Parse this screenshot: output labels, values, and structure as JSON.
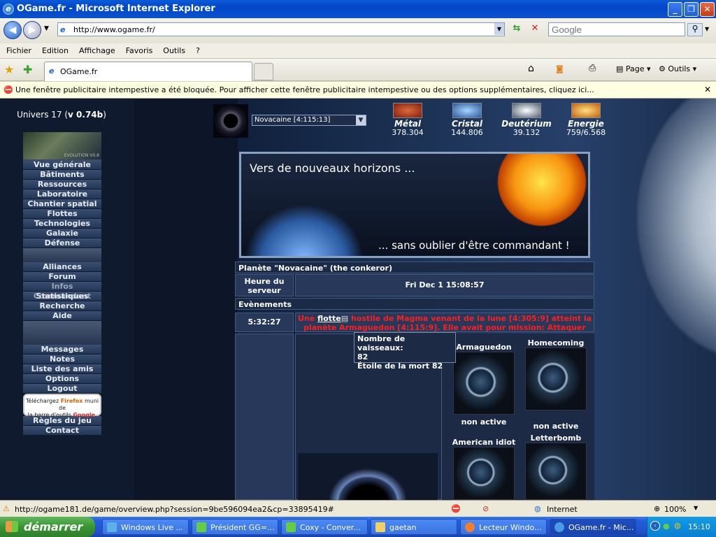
{
  "window": {
    "title": "OGame.fr - Microsoft Internet Explorer"
  },
  "address": {
    "url": "http://www.ogame.fr/",
    "search_placeholder": "Google"
  },
  "menu": [
    "Fichier",
    "Edition",
    "Affichage",
    "Favoris",
    "Outils",
    "?"
  ],
  "tab": {
    "label": "OGame.fr"
  },
  "toolbar": {
    "page_label": "Page",
    "tools_label": "Outils"
  },
  "popup_bar": {
    "text": "Une fenêtre publicitaire intempestive a été bloquée. Pour afficher cette fenêtre publicitaire intempestive ou des options supplémentaires, cliquez ici..."
  },
  "sidebar": {
    "univers": "Univers 17 (",
    "version": "v 0.74b",
    "univers_end": ")",
    "logo_caption": "EVOLUTION V0.8",
    "items_group1": [
      "Vue générale",
      "Bâtiments",
      "Ressources",
      "Laboratoire",
      "Chantier spatial",
      "Flottes",
      "Technologies",
      "Galaxie",
      "Défense"
    ],
    "items_group2": [
      "Alliances",
      "Forum",
      "Infos Commandant",
      "Statistiques",
      "Recherche",
      "Aide"
    ],
    "items_group3": [
      "Messages",
      "Notes",
      "Liste des amis",
      "Options",
      "Logout"
    ],
    "firefox_promo": {
      "l1": "Téléchargez ",
      "brand": "Firefox",
      "l2": " muni de",
      "l3": "la barre d'outils ",
      "google": "Google",
      "l4": "."
    },
    "items_group4": [
      "Règles du jeu",
      "Contact"
    ]
  },
  "planet_select": {
    "value": "Novacaine [4:115:13]"
  },
  "resources": [
    {
      "name": "Métal",
      "value": "378.304",
      "color": "#c0481c"
    },
    {
      "name": "Cristal",
      "value": "144.806",
      "color": "#4a86c8"
    },
    {
      "name": "Deutérium",
      "value": "39.132",
      "color": "#dfe6ee"
    },
    {
      "name": "Energie",
      "value": "759/6.568",
      "color": "#e08a20"
    }
  ],
  "banner": {
    "line1": "Vers de nouveaux horizons ...",
    "line2": "... sans oublier d'être commandant !"
  },
  "overview": {
    "planet_header": "Planète \"Novacaine\" (the conkeror)",
    "server_time_label_1": "Heure du",
    "server_time_label_2": "serveur",
    "server_time": "Fri Dec 1 15:08:57",
    "events_header": "Evènements",
    "event_countdown": "5:32:27",
    "event_prefix": "Une ",
    "event_link": "flotte",
    "event_text": " hostile de Magma venant de la lune [4:305:9] atteint la planète Armaguedon [4:115:9]. Elle avait pour mission: Attaquer"
  },
  "tooltip": {
    "line1": "Nombre de vaisseaux:",
    "line2": "82",
    "line3": "Étoile de la mort 82"
  },
  "moons": [
    {
      "name": "Armaguedon",
      "status": "non active"
    },
    {
      "name": "Homecoming",
      "status": "non active"
    },
    {
      "name": "American idiot",
      "status": ""
    },
    {
      "name": "Letterbomb",
      "status": ""
    }
  ],
  "statusbar": {
    "url": "http://ogame181.de/game/overview.php?session=9be596094ea2&cp=33895419#",
    "zone": "Internet",
    "zoom": "100%"
  },
  "taskbar": {
    "start": "démarrer",
    "tasks": [
      "Windows Live ...",
      "Président GG=...",
      "Coxy - Conver...",
      "gaetan",
      "Lecteur Windo...",
      "OGame.fr - Mic..."
    ],
    "clock": "15:10"
  }
}
